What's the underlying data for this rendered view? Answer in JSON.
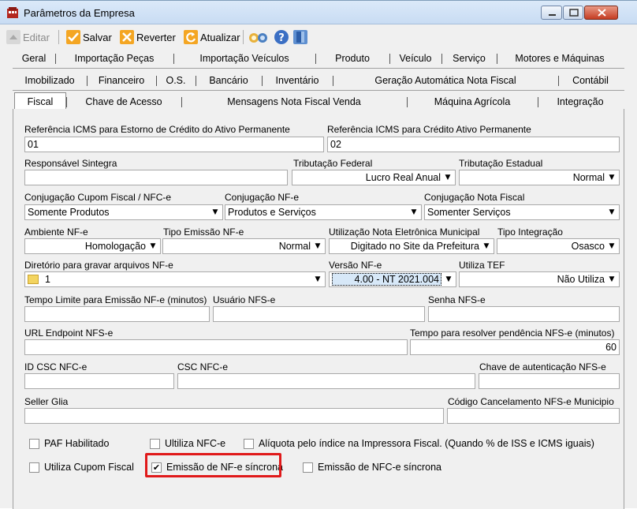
{
  "window": {
    "title": "Parâmetros da Empresa"
  },
  "toolbar": {
    "editar": "Editar",
    "salvar": "Salvar",
    "reverter": "Reverter",
    "atualizar": "Atualizar"
  },
  "tabs_row1": [
    "Geral",
    "Importação Peças",
    "Importação Veículos",
    "Produto",
    "Veículo",
    "Serviço",
    "Motores e Máquinas"
  ],
  "tabs_row2": [
    "Imobilizado",
    "Financeiro",
    "O.S.",
    "Bancário",
    "Inventário",
    "Geração Automática Nota Fiscal",
    "Contábil"
  ],
  "tabs_row3": [
    "Fiscal",
    "Chave de Acesso",
    "Mensagens Nota Fiscal Venda",
    "Máquina Agrícola",
    "Integração"
  ],
  "form": {
    "ref_icms_estorno_label": "Referência ICMS para Estorno de Crédito do Ativo Permanente",
    "ref_icms_estorno_value": "01",
    "ref_icms_credito_label": "Referência ICMS para Crédito Ativo Permanente",
    "ref_icms_credito_value": "02",
    "responsavel_label": "Responsável Sintegra",
    "responsavel_value": "",
    "trib_federal_label": "Tributação Federal",
    "trib_federal_value": "Lucro Real Anual",
    "trib_estadual_label": "Tributação Estadual",
    "trib_estadual_value": "Normal",
    "conj_cupom_label": "Conjugação Cupom Fiscal / NFC-e",
    "conj_cupom_value": "Somente Produtos",
    "conj_nfe_label": "Conjugação NF-e",
    "conj_nfe_value": "Produtos e Serviços",
    "conj_nota_label": "Conjugação Nota Fiscal",
    "conj_nota_value": "Somenter Serviços",
    "ambiente_label": "Ambiente NF-e",
    "ambiente_value": "Homologação",
    "tipo_emissao_label": "Tipo Emissão NF-e",
    "tipo_emissao_value": "Normal",
    "util_nota_label": "Utilização Nota Eletrônica Municipal",
    "util_nota_value": "Digitado no Site da Prefeitura",
    "tipo_integracao_label": "Tipo Integração",
    "tipo_integracao_value": "Osasco",
    "diretorio_label": "Diretório para gravar arquivos NF-e",
    "diretorio_value": "1",
    "versao_label": "Versão NF-e",
    "versao_value": "4.00 - NT 2021.004",
    "utiliza_tef_label": "Utiliza TEF",
    "utiliza_tef_value": "Não Utiliza",
    "tempo_limite_label": "Tempo Limite para Emissão NF-e (minutos)",
    "tempo_limite_value": "",
    "usuario_nfse_label": "Usuário NFS-e",
    "usuario_nfse_value": "",
    "senha_nfse_label": "Senha NFS-e",
    "senha_nfse_value": "",
    "url_endpoint_label": "URL Endpoint NFS-e",
    "url_endpoint_value": "",
    "tempo_resolver_label": "Tempo para resolver pendência NFS-e (minutos)",
    "tempo_resolver_value": "60",
    "id_csc_label": "ID CSC NFC-e",
    "id_csc_value": "",
    "csc_label": "CSC NFC-e",
    "csc_value": "",
    "chave_auth_label": "Chave de autenticação NFS-e",
    "chave_auth_value": "",
    "seller_label": "Seller Glia",
    "seller_value": "",
    "cod_cancel_label": "Código Cancelamento NFS-e Municipio",
    "cod_cancel_value": ""
  },
  "checkboxes": {
    "paf": {
      "label": "PAF Habilitado",
      "checked": false
    },
    "utiliza_nfce": {
      "label": "Ultiliza NFC-e",
      "checked": false
    },
    "aliquota": {
      "label": "Alíquota pelo índice na Impressora Fiscal. (Quando % de ISS e ICMS iguais)",
      "checked": false
    },
    "cupom_fiscal": {
      "label": "Utiliza Cupom Fiscal",
      "checked": false
    },
    "nfe_sincrona": {
      "label": "Emissão de NF-e síncrona",
      "checked": true
    },
    "nfce_sincrona": {
      "label": "Emissão de NFC-e síncrona",
      "checked": false
    }
  },
  "glyphs": {
    "check": "✔",
    "arrow": "▼"
  },
  "colors": {
    "highlight": "#e0191a",
    "titlebar": "#c8dcf3"
  }
}
